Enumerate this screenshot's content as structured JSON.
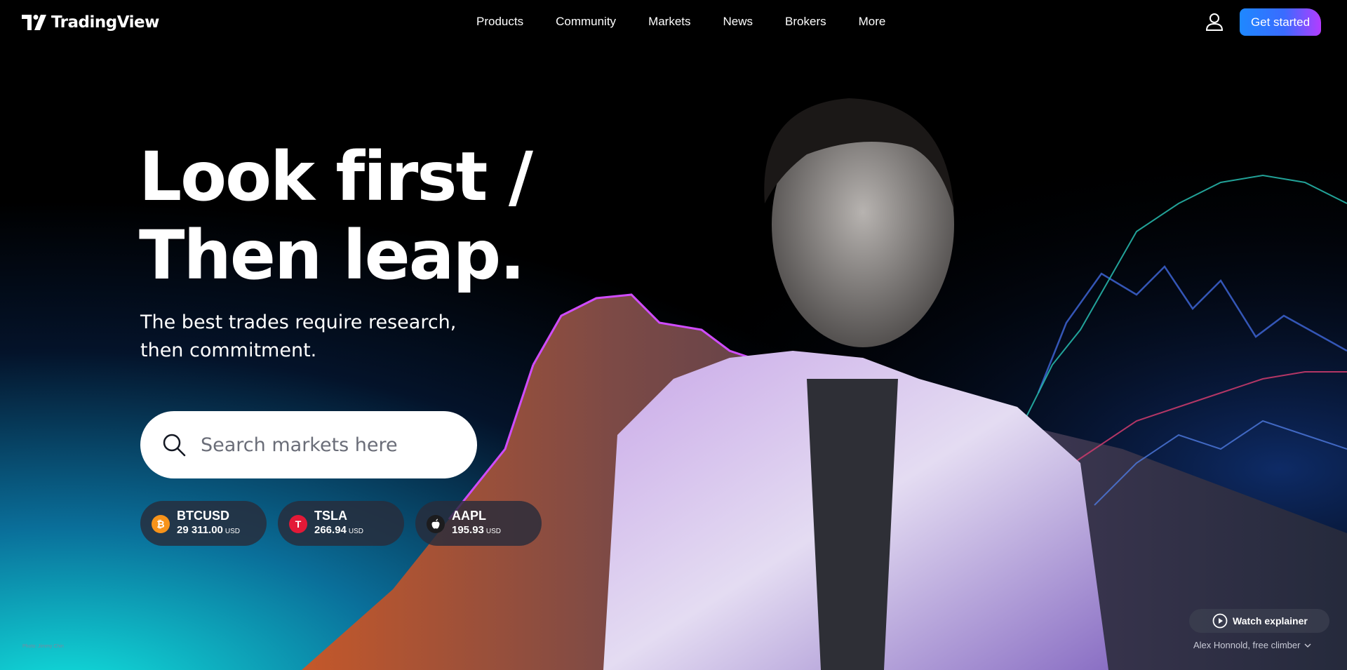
{
  "header": {
    "logo_text": "TradingView",
    "nav": [
      "Products",
      "Community",
      "Markets",
      "News",
      "Brokers",
      "More"
    ],
    "cta_label": "Get started"
  },
  "hero": {
    "headline_line1": "Look first /",
    "headline_line2": "Then leap.",
    "subtitle": "The best trades require research, then commitment.",
    "search_placeholder": "Search markets here"
  },
  "tickers": [
    {
      "symbol": "BTCUSD",
      "price": "29 311.00",
      "currency": "USD",
      "icon": "bitcoin-icon",
      "color": "#f7931a",
      "glyph": "₿"
    },
    {
      "symbol": "TSLA",
      "price": "266.94",
      "currency": "USD",
      "icon": "tesla-icon",
      "color": "#e31937",
      "glyph": "T"
    },
    {
      "symbol": "AAPL",
      "price": "195.93",
      "currency": "USD",
      "icon": "apple-icon",
      "color": "#1c1c1e",
      "glyph": ""
    }
  ],
  "footer": {
    "watch_label": "Watch explainer",
    "caption": "Alex Honnold, free climber",
    "photo_credit": "Photo: Jimmy Chin"
  },
  "colors": {
    "cta_start": "#1e88ff",
    "cta_end": "#b43cff",
    "background": "#000000"
  }
}
